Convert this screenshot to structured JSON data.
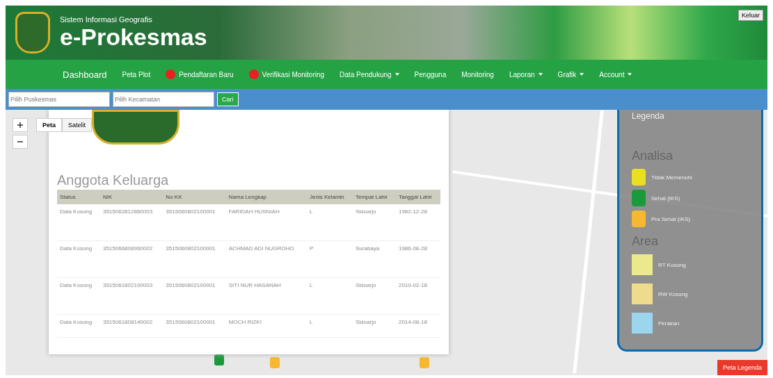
{
  "header": {
    "subtitle": "Sistem Informasi Geografis",
    "title": "e-Prokesmas",
    "logout": "Keluar"
  },
  "nav": [
    {
      "label": "Dashboard",
      "badge": false,
      "dropdown": false,
      "selected": true
    },
    {
      "label": "Peta Plot",
      "badge": false,
      "dropdown": false,
      "selected": false
    },
    {
      "label": "Pendaftaran Baru",
      "badge": true,
      "dropdown": false,
      "selected": false
    },
    {
      "label": "Verifikasi Monitoring",
      "badge": true,
      "dropdown": false,
      "selected": false
    },
    {
      "label": "Data Pendukung",
      "badge": false,
      "dropdown": true,
      "selected": false
    },
    {
      "label": "Pengguna",
      "badge": false,
      "dropdown": false,
      "selected": false
    },
    {
      "label": "Monitoring",
      "badge": false,
      "dropdown": false,
      "selected": false
    },
    {
      "label": "Laporan",
      "badge": false,
      "dropdown": true,
      "selected": false
    },
    {
      "label": "Grafik",
      "badge": false,
      "dropdown": true,
      "selected": false
    },
    {
      "label": "Account",
      "badge": false,
      "dropdown": true,
      "selected": false
    }
  ],
  "filters": [
    {
      "placeholder": "Pilih Puskesmas"
    },
    {
      "placeholder": "Pilih Kecamatan"
    }
  ],
  "filter_button": "Cari",
  "map_types": [
    {
      "label": "Peta",
      "selected": true
    },
    {
      "label": "Satelit",
      "selected": false
    }
  ],
  "popup": {
    "title": "Anggota Keluarga",
    "columns": [
      "Status",
      "NIK",
      "No KK",
      "Nama Lengkap",
      "Jenis Kelamin",
      "Tempat Lahir",
      "Tanggal Lahir"
    ],
    "rows": [
      [
        "Data Kosong",
        "3515062812860003",
        "3515060802100001",
        "FARIDAH HUSNIAH",
        "L",
        "Sidoarjo",
        "1982-12-28"
      ],
      [
        "Data Kosong",
        "3515066808960002",
        "3515060802100001",
        "ACHMAD ADI NUGROHO",
        "P",
        "Surabaya",
        "1986-08-28"
      ],
      [
        "Data Kosong",
        "3515061802100003",
        "3515060802100001",
        "SITI NUR HASANAH",
        "L",
        "Sidoarjo",
        "2010-02-18"
      ],
      [
        "Data Kosong",
        "3515061808140002",
        "3515060802100001",
        "MOCH RIZKI",
        "L",
        "Sidoarjo",
        "2014-08-18"
      ]
    ]
  },
  "legend": {
    "title": "Legenda",
    "sections": [
      {
        "title": "Analisa",
        "items": [
          {
            "kind": "marker",
            "label": "Tidak Memenuhi",
            "color": "#e8e020"
          },
          {
            "kind": "marker",
            "label": "Sehat (IKS)",
            "color": "#1a9a3a"
          },
          {
            "kind": "marker",
            "label": "Pra Sehat (IKS)",
            "color": "#f6b830"
          }
        ]
      },
      {
        "title": "Area",
        "items": [
          {
            "kind": "area",
            "label": "RT Kosong",
            "color": "#eaea8c"
          },
          {
            "kind": "area",
            "label": "RW Kosong",
            "color": "#eedb8e"
          },
          {
            "kind": "area",
            "label": "Perairan",
            "color": "#9cd6ee"
          }
        ]
      }
    ]
  },
  "legend_button": "Peta Legenda"
}
